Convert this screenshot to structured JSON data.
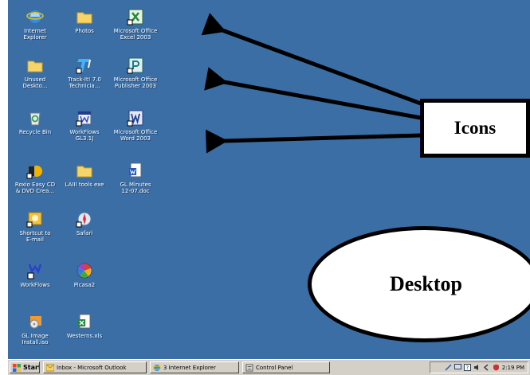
{
  "desktop": {
    "background_color": "#3a6ea5",
    "icons": [
      {
        "label": "Internet\nExplorer",
        "icon": "internet-explorer-icon"
      },
      {
        "label": "Photos",
        "icon": "folder-icon"
      },
      {
        "label": "Microsoft Office\nExcel 2003",
        "icon": "excel-icon"
      },
      {
        "label": "Unused\nDeskto...",
        "icon": "folder-icon"
      },
      {
        "label": "Track-It! 7.0\nTechnicia...",
        "icon": "track-it-icon"
      },
      {
        "label": "Microsoft Office\nPublisher 2003",
        "icon": "publisher-icon"
      },
      {
        "label": "Recycle Bin",
        "icon": "recycle-bin-icon"
      },
      {
        "label": "WorkFlows\nGL3.1J",
        "icon": "workflows-doc-icon"
      },
      {
        "label": "Microsoft Office\nWord 2003",
        "icon": "word-icon"
      },
      {
        "label": "Roxio Easy CD\n& DVD Crea...",
        "icon": "roxio-icon"
      },
      {
        "label": "LAIII tools exe",
        "icon": "folder-icon"
      },
      {
        "label": "GL Minutes\n12-07.doc",
        "icon": "word-document-icon"
      },
      {
        "label": "Shortcut to\nE-mail",
        "icon": "email-shortcut-icon"
      },
      {
        "label": "Safari",
        "icon": "safari-icon"
      },
      {
        "label": "WorkFlows",
        "icon": "workflows-icon"
      },
      {
        "label": "Picasa2",
        "icon": "picasa-icon"
      },
      {
        "label": "GL Image\nInstall.iso",
        "icon": "disc-image-icon"
      },
      {
        "label": "Westerns.xls",
        "icon": "excel-document-icon"
      }
    ]
  },
  "taskbar": {
    "start_label": "Start",
    "buttons": [
      {
        "label": "Inbox - Microsoft Outlook",
        "icon": "outlook-icon"
      },
      {
        "label": "3 Internet Explorer",
        "icon": "internet-explorer-icon"
      },
      {
        "label": "Control Panel",
        "icon": "control-panel-icon"
      }
    ],
    "clock": "2:19 PM"
  },
  "callouts": {
    "icons_label": "Icons",
    "desktop_label": "Desktop"
  }
}
